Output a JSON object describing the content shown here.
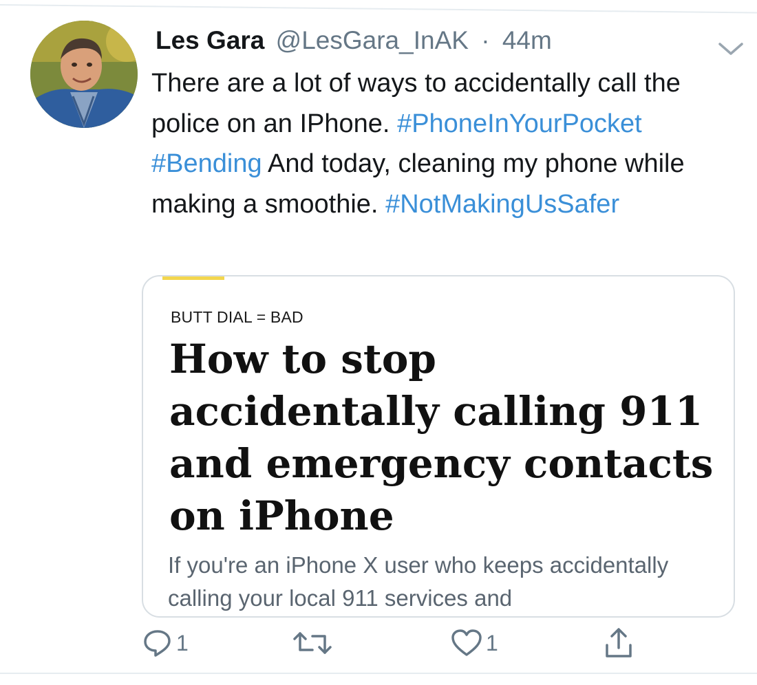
{
  "tweet": {
    "author_name": "Les Gara",
    "author_handle": "@LesGara_InAK",
    "separator": "·",
    "timestamp": "44m",
    "text_part1": "There are a lot of ways to accidentally call the police on an IPhone. ",
    "hashtag1": "#PhoneInYourPocket",
    "hashtag2": "#Bending",
    "text_part2": " And today, cleaning my phone while making a smoothie. ",
    "hashtag3": "#NotMakingUsSafer"
  },
  "card": {
    "kicker": "BUTT DIAL = BAD",
    "headline": "How to stop accidentally calling 911 and emergency contacts on iPhone",
    "summary": "If you're an iPhone X user who keeps accidentally calling your local 911 services and"
  },
  "actions": {
    "reply_count": "1",
    "like_count": "1"
  },
  "icons": {
    "avatar": "avatar-photo",
    "caret": "chevron-down-icon",
    "reply": "reply-icon",
    "retweet": "retweet-icon",
    "like": "heart-icon",
    "share": "share-icon"
  },
  "colors": {
    "hashtag": "#3a8fd8",
    "secondary_text": "#657786",
    "card_accent": "#f3d64e"
  }
}
